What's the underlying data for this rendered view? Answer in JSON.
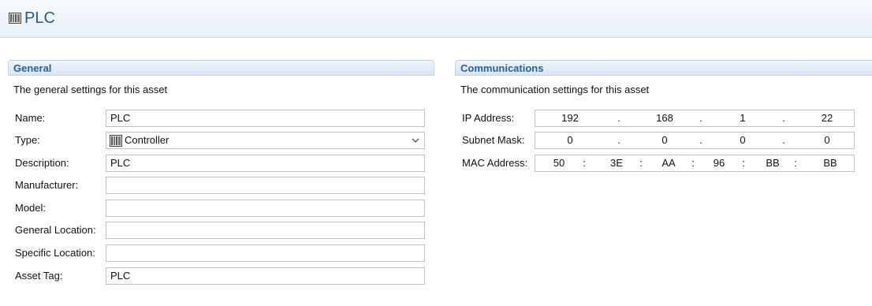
{
  "page": {
    "title": "PLC",
    "icon": "plc-rack-icon"
  },
  "general": {
    "title": "General",
    "description": "The general settings for this asset",
    "fields": [
      {
        "label": "Name:",
        "value": "PLC"
      },
      {
        "label": "Type:",
        "value": "Controller",
        "icon": "controller-icon"
      },
      {
        "label": "Description:",
        "value": "PLC"
      },
      {
        "label": "Manufacturer:",
        "value": ""
      },
      {
        "label": "Model:",
        "value": ""
      },
      {
        "label": "General Location:",
        "value": ""
      },
      {
        "label": "Specific Location:",
        "value": ""
      },
      {
        "label": "Asset Tag:",
        "value": "PLC"
      }
    ]
  },
  "communications": {
    "title": "Communications",
    "description": "The communication settings for this asset",
    "ip": {
      "label": "IP Address:",
      "octets": [
        "192",
        "168",
        "1",
        "22"
      ],
      "separator": "."
    },
    "subnet": {
      "label": "Subnet Mask:",
      "octets": [
        "0",
        "0",
        "0",
        "0"
      ],
      "separator": "."
    },
    "mac": {
      "label": "MAC Address:",
      "octets": [
        "50",
        "3E",
        "AA",
        "96",
        "BB",
        "BB"
      ],
      "separator": ":"
    }
  },
  "colors": {
    "accent": "#1f5d97",
    "section_title": "#2a6099",
    "border": "#b8c4d2"
  }
}
